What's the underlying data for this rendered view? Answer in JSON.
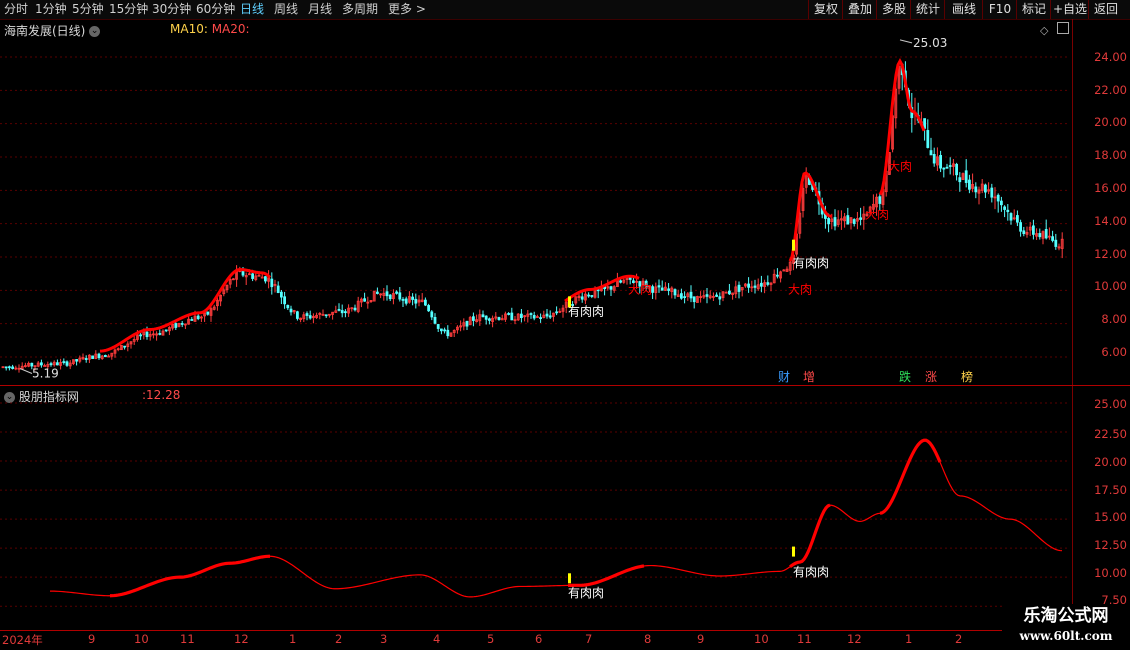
{
  "toolbar": {
    "periods": [
      "分时",
      "1分钟",
      "5分钟",
      "15分钟",
      "30分钟",
      "60分钟",
      "日线",
      "周线",
      "月线",
      "多周期",
      "更多"
    ],
    "active_period": "日线",
    "more_arrow": ">",
    "right_buttons": [
      "复权",
      "叠加",
      "多股",
      "统计",
      "画线",
      "F10",
      "标记",
      "+自选",
      "返回"
    ]
  },
  "main_pane": {
    "title": "海南发展(日线)",
    "ma10_label": "MA10:",
    "ma20_label": "MA20:",
    "high_label": "25.03",
    "low_label": "5.19",
    "signal_labels": [
      "有肉肉",
      "有肉肉",
      "大肉",
      "大肉",
      "大肉",
      "大肉"
    ],
    "y_ticks": [
      "24.00",
      "22.00",
      "20.00",
      "18.00",
      "16.00",
      "14.00",
      "12.00",
      "10.00",
      "8.00",
      "6.00"
    ],
    "event_tags": [
      {
        "text": "财",
        "color": "#3a9cff"
      },
      {
        "text": "增",
        "color": "#ff4a4a"
      },
      {
        "text": "跌",
        "color": "#2ee05a"
      },
      {
        "text": "涨",
        "color": "#ff4a4a"
      },
      {
        "text": "榜",
        "color": "#ffd24a"
      }
    ]
  },
  "indicator_pane": {
    "title": "股朋指标网",
    "value": ":12.28",
    "signal_labels": [
      "有肉肉",
      "有肉肉"
    ],
    "y_ticks": [
      "25.00",
      "22.50",
      "20.00",
      "17.50",
      "15.00",
      "12.50",
      "10.00",
      "7.50"
    ]
  },
  "x_axis": [
    "2024年",
    "9",
    "10",
    "11",
    "12",
    "1",
    "2",
    "3",
    "4",
    "5",
    "6",
    "7",
    "8",
    "9",
    "10",
    "11",
    "12",
    "1",
    "2"
  ],
  "watermark": {
    "line1": "乐淘公式网",
    "line2": "www.60lt.com"
  },
  "colors": {
    "up": "#ff3c3c",
    "down": "#54ffff",
    "grid": "#5a0000",
    "signal": "#ff0000",
    "alert": "#ffff00"
  },
  "chart_data": {
    "type": "line",
    "title": "海南发展(日线)",
    "x": [
      "2024-08",
      "2024-09",
      "2024-10",
      "2024-11",
      "2024-12",
      "2025-01",
      "2025-02",
      "2025-03",
      "2025-04",
      "2025-05",
      "2025-06",
      "2025-07",
      "2025-08",
      "2025-09",
      "2025-10",
      "2025-11",
      "2025-12",
      "2026-01",
      "2026-02"
    ],
    "series": [
      {
        "name": "price_close",
        "values": [
          5.5,
          6.2,
          7.3,
          8.2,
          11.0,
          8.5,
          8.9,
          9.8,
          8.0,
          8.8,
          9.0,
          9.5,
          10.0,
          10.2,
          10.8,
          16.0,
          14.5,
          19.0,
          12.8
        ]
      },
      {
        "name": "股朋指标网",
        "values": [
          7.8,
          8.5,
          9.0,
          10.2,
          11.7,
          8.6,
          9.4,
          10.2,
          7.5,
          8.8,
          9.1,
          9.8,
          10.8,
          9.6,
          10.4,
          16.2,
          15.3,
          21.5,
          12.28
        ]
      }
    ],
    "ylim_main": [
      5.0,
      25.5
    ],
    "ylim_indicator": [
      7.5,
      25.0
    ],
    "high": 25.03,
    "low": 5.19
  }
}
